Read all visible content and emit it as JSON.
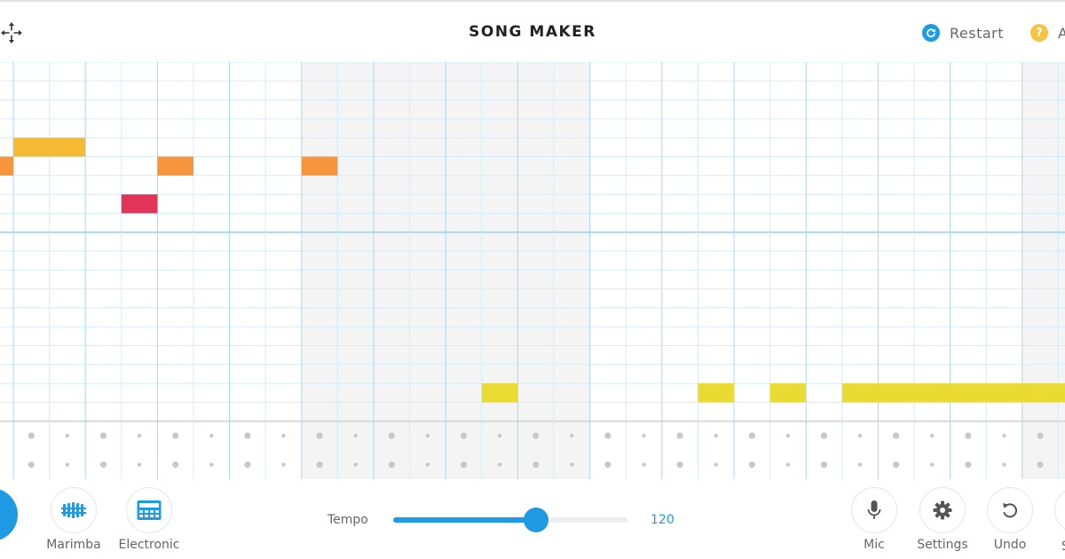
{
  "header": {
    "title": "SONG MAKER",
    "restart_label": "Restart",
    "about_label": "A",
    "about_icon_glyph": "?"
  },
  "colors": {
    "accent": "#1e9be4",
    "about_icon": "#f6c244",
    "grid_line": "#d3ecf8",
    "grid_line_strong": "#a8d8f0",
    "shaded_measure": "#f4f4f4",
    "percussion_dot": "#c8c8c8"
  },
  "grid": {
    "melody_rows": 19,
    "columns": 30,
    "beats_per_bar": 4,
    "shaded_bars": [
      2,
      3,
      7
    ],
    "notes": [
      {
        "row": 5,
        "col": 0,
        "length": 1,
        "color": "#f6953c"
      },
      {
        "row": 4,
        "col": 0,
        "length": 2,
        "color": "#f4bb33"
      },
      {
        "row": 5,
        "col": 4,
        "length": 1,
        "color": "#f6953c"
      },
      {
        "row": 7,
        "col": 3,
        "length": 1,
        "color": "#e33358"
      },
      {
        "row": 5,
        "col": 8,
        "length": 1,
        "color": "#f6953c"
      },
      {
        "row": 17,
        "col": 13,
        "length": 1,
        "color": "#eadb33"
      },
      {
        "row": 17,
        "col": 19,
        "length": 1,
        "color": "#eadb33"
      },
      {
        "row": 17,
        "col": 21,
        "length": 1,
        "color": "#eadb33"
      },
      {
        "row": 17,
        "col": 23,
        "length": 7,
        "color": "#eadb33"
      }
    ],
    "percussion_rows": 2
  },
  "toolbar": {
    "instrument_1_label": "Marimba",
    "instrument_1_icon": "marimba-icon",
    "instrument_2_label": "Electronic",
    "instrument_2_icon": "drum-machine-icon",
    "tempo_label": "Tempo",
    "tempo_value": "120",
    "tempo_fraction": 0.61,
    "mic_label": "Mic",
    "settings_label": "Settings",
    "undo_label": "Undo",
    "save_label_partial": "S"
  }
}
